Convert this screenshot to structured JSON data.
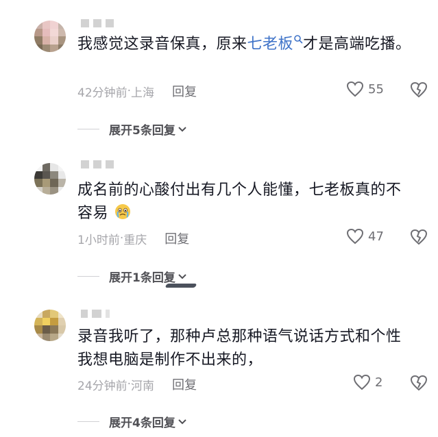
{
  "comments": [
    {
      "text_before": "我感觉这录音保真，原来",
      "link": "七老板",
      "text_after": "才是高端吃播。",
      "time": "42分钟前",
      "location": "上海",
      "reply_label": "回复",
      "likes": "55",
      "expand_label": "展开5条回复"
    },
    {
      "text": "成名前的心酸付出有几个人能懂，七老板真的不容易",
      "emoji": "crying-face-emoji",
      "time": "1小时前",
      "location": "重庆",
      "reply_label": "回复",
      "likes": "47",
      "expand_label": "展开1条回复"
    },
    {
      "text": "录音我听了，那种卢总那种语气说话方式和个性我想电脑是制作不出来的，",
      "time": "24分钟前",
      "location": "河南",
      "reply_label": "回复",
      "likes": "2",
      "expand_label": "展开4条回复"
    }
  ],
  "separator": " · ",
  "colors": {
    "link": "#3f73c8",
    "meta": "#a5a5aa",
    "text": "#161823"
  }
}
